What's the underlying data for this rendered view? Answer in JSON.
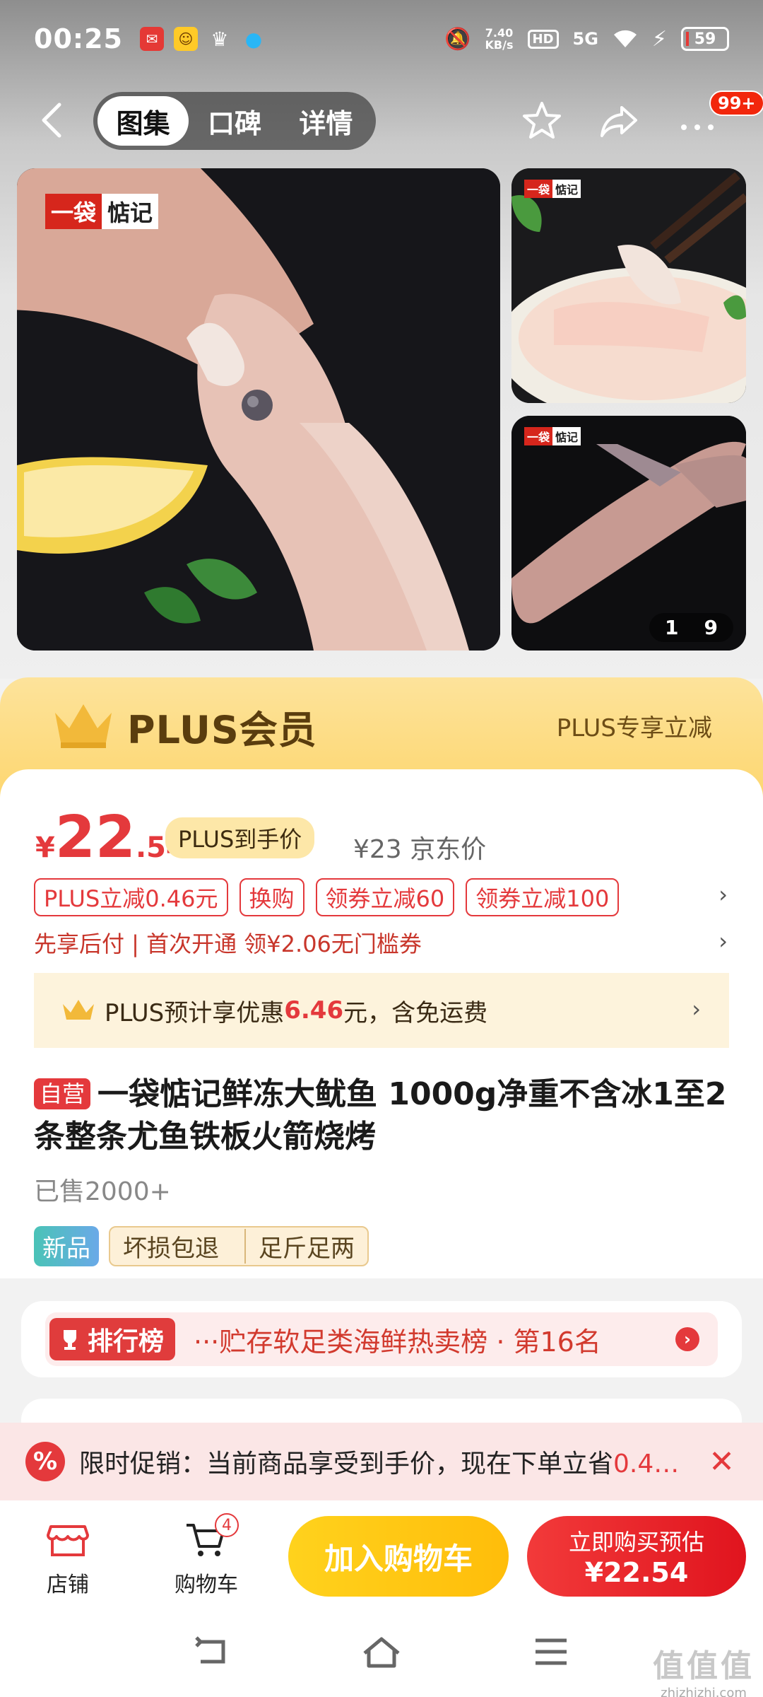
{
  "status_bar": {
    "time": "00:25",
    "net_speed_value": "7.40",
    "net_speed_unit": "KB/s",
    "hd": "HD",
    "signal": "5G",
    "battery": "59"
  },
  "nav": {
    "tabs": [
      {
        "label": "图集",
        "active": true
      },
      {
        "label": "口碑",
        "active": false
      },
      {
        "label": "详情",
        "active": false
      }
    ],
    "more_badge": "99+"
  },
  "gallery": {
    "brand_tag_a": "一袋",
    "brand_tag_b": "惦记",
    "page_current": "1",
    "page_total": "9"
  },
  "plus_banner": {
    "title": "PLUS会员",
    "right_text": "PLUS专享立减"
  },
  "price": {
    "symbol": "¥",
    "integer": "22",
    "decimal": ".54",
    "plus_label": "PLUS到手价",
    "jd_price": "¥23 京东价"
  },
  "promo_tags": [
    "PLUS立减0.46元",
    "换购",
    "领券立减60",
    "领券立减100"
  ],
  "pay_later": "先享后付 | 首次开通 领¥2.06无门槛券",
  "plus_info": {
    "prefix": "PLUS预计享优惠",
    "amount": "6.46",
    "suffix": "元，含免运费"
  },
  "product": {
    "self_run": "自营",
    "title": "一袋惦记鲜冻大鱿鱼 1000g净重不含冰1至2条整条尤鱼铁板火箭烧烤",
    "sold": "已售2000+",
    "new_tag": "新品",
    "service_tags": [
      "坏损包退",
      "足斤足两"
    ]
  },
  "rank": {
    "badge": "排行榜",
    "text": "···贮存软足类海鲜热卖榜 · 第16名"
  },
  "promo_bar": {
    "prefix": "限时促销：当前商品享受到手价，现在下单立省",
    "highlight": "0.4…"
  },
  "actions": {
    "store": "店铺",
    "cart": "购物车",
    "cart_count": "4",
    "add_to_cart": "加入购物车",
    "buy_now": "立即购买预估",
    "buy_price": "¥22.54"
  },
  "watermark": {
    "main": "值值值",
    "url": "zhizhizhi.com"
  },
  "colors": {
    "accent_red": "#e4393c",
    "plus_gold": "#fdd56b",
    "cart_yellow": "#ffc913"
  }
}
